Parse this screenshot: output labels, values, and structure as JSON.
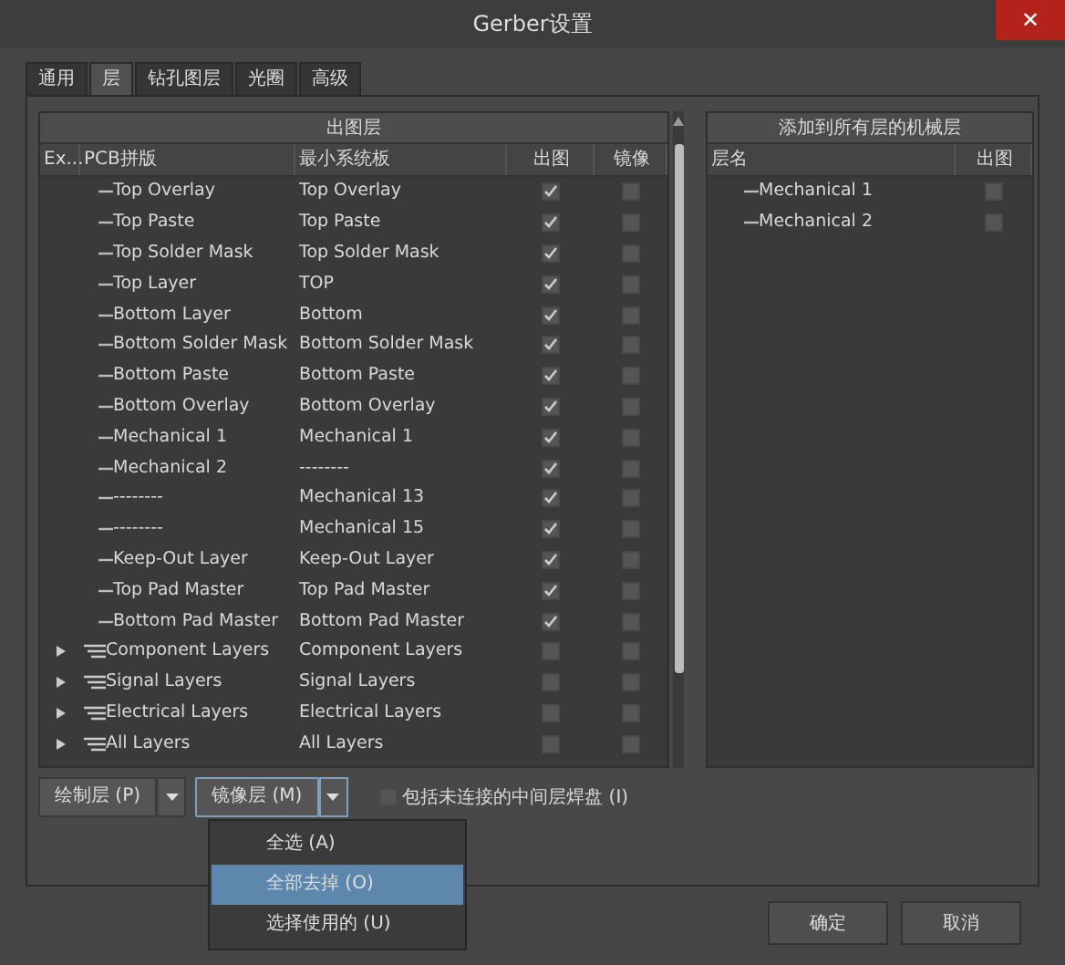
{
  "window": {
    "title": "Gerber设置",
    "close": "✕"
  },
  "tabs": [
    {
      "label": "通用",
      "selected": false
    },
    {
      "label": "层",
      "selected": true
    },
    {
      "label": "钻孔图层",
      "selected": false
    },
    {
      "label": "光圈",
      "selected": false
    },
    {
      "label": "高级",
      "selected": false
    }
  ],
  "layers_panel": {
    "title": "出图层",
    "columns": [
      "Ex...",
      "PCB拼版",
      "最小系统板",
      "出图",
      "镜像"
    ],
    "rows": [
      {
        "kind": "layer",
        "name": "Top Overlay",
        "board": "Top Overlay",
        "plot": true,
        "mirror": false
      },
      {
        "kind": "layer",
        "name": "Top Paste",
        "board": "Top Paste",
        "plot": true,
        "mirror": false
      },
      {
        "kind": "layer",
        "name": "Top Solder Mask",
        "board": "Top Solder Mask",
        "plot": true,
        "mirror": false
      },
      {
        "kind": "layer",
        "name": "Top Layer",
        "board": "TOP",
        "plot": true,
        "mirror": false
      },
      {
        "kind": "layer",
        "name": "Bottom Layer",
        "board": "Bottom",
        "plot": true,
        "mirror": false
      },
      {
        "kind": "layer",
        "name": "Bottom Solder Mask",
        "board": "Bottom Solder Mask",
        "plot": true,
        "mirror": false
      },
      {
        "kind": "layer",
        "name": "Bottom Paste",
        "board": "Bottom Paste",
        "plot": true,
        "mirror": false
      },
      {
        "kind": "layer",
        "name": "Bottom Overlay",
        "board": "Bottom Overlay",
        "plot": true,
        "mirror": false
      },
      {
        "kind": "layer",
        "name": "Mechanical 1",
        "board": "Mechanical 1",
        "plot": true,
        "mirror": false
      },
      {
        "kind": "layer",
        "name": "Mechanical 2",
        "board": "--------",
        "plot": true,
        "mirror": false
      },
      {
        "kind": "layer",
        "name": "--------",
        "board": "Mechanical 13",
        "plot": true,
        "mirror": false
      },
      {
        "kind": "layer",
        "name": "--------",
        "board": "Mechanical 15",
        "plot": true,
        "mirror": false
      },
      {
        "kind": "layer",
        "name": "Keep-Out Layer",
        "board": "Keep-Out Layer",
        "plot": true,
        "mirror": false
      },
      {
        "kind": "layer",
        "name": "Top Pad Master",
        "board": "Top Pad Master",
        "plot": true,
        "mirror": false
      },
      {
        "kind": "layer",
        "name": "Bottom Pad Master",
        "board": "Bottom Pad Master",
        "plot": true,
        "mirror": false
      },
      {
        "kind": "group",
        "expanded": false,
        "name": "Component Layers",
        "board": "Component Layers",
        "plot": false,
        "mirror": false
      },
      {
        "kind": "group",
        "expanded": false,
        "name": "Signal Layers",
        "board": "Signal Layers",
        "plot": false,
        "mirror": false
      },
      {
        "kind": "group",
        "expanded": false,
        "name": "Electrical Layers",
        "board": "Electrical Layers",
        "plot": false,
        "mirror": false
      },
      {
        "kind": "group",
        "expanded": false,
        "name": "All Layers",
        "board": "All Layers",
        "plot": false,
        "mirror": false
      }
    ]
  },
  "mech_panel": {
    "title": "添加到所有层的机械层",
    "columns": [
      "层名",
      "出图"
    ],
    "rows": [
      {
        "name": "Mechanical 1",
        "plot": false
      },
      {
        "name": "Mechanical 2",
        "plot": false
      }
    ]
  },
  "plot_button": {
    "label": "绘制层 (P)",
    "expanded": false
  },
  "mirror_button": {
    "label": "镜像层 (M)",
    "expanded": true
  },
  "pads_checkbox": {
    "label": "包括未连接的中间层焊盘 (I)",
    "checked": false
  },
  "menu": {
    "items": [
      {
        "label": "全选 (A)",
        "selected": false
      },
      {
        "label": "全部去掉 (O)",
        "selected": true
      },
      {
        "label": "选择使用的 (U)",
        "selected": false
      }
    ]
  },
  "footer_buttons": [
    "确定",
    "取消"
  ]
}
